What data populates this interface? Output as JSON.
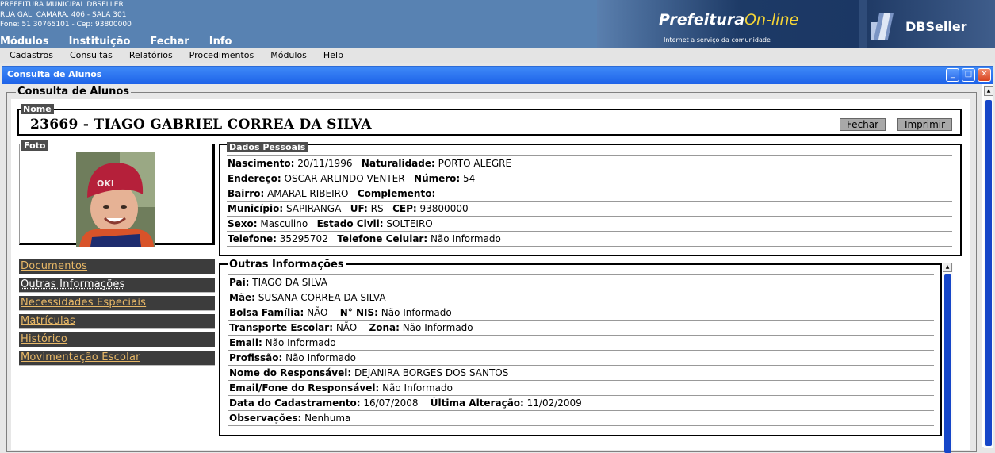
{
  "header": {
    "org_line1": "PREFEITURA MUNICIPAL DBSELLER",
    "org_line2": "RUA GAL. CAMARA, 406 - SALA 301",
    "org_line3": "Fone: 51 30765101  -  Cep: 93800000",
    "top_menu": [
      "Módulos",
      "Instituição",
      "Fechar",
      "Info"
    ],
    "banner_title_a": "Prefeitura",
    "banner_title_b": "On-line",
    "banner_subtitle": "Internet a serviço da comunidade",
    "brand": "DBSeller"
  },
  "menubar": [
    "Cadastros",
    "Consultas",
    "Relatórios",
    "Procedimentos",
    "Módulos",
    "Help"
  ],
  "window": {
    "title": "Consulta de Alunos",
    "min": "_",
    "max": "□",
    "close": "✕"
  },
  "form": {
    "legend": "Consulta de Alunos",
    "name_legend": "Nome",
    "student_line": "23669  -  TIAGO GABRIEL CORREA DA SILVA",
    "btn_fechar": "Fechar",
    "btn_imprimir": "Imprimir",
    "foto_legend": "Foto",
    "dados_legend": "Dados Pessoais",
    "outras_legend": "Outras Informações"
  },
  "nav": [
    "Documentos",
    "Outras Informações",
    "Necessidades Especiais",
    "Matrículas",
    "Histórico",
    "Movimentação Escolar"
  ],
  "dados": {
    "nascimento_l": "Nascimento:",
    "nascimento_v": " 20/11/1996",
    "naturalidade_l": "Naturalidade:",
    "naturalidade_v": " PORTO ALEGRE",
    "endereco_l": "Endereço:",
    "endereco_v": " OSCAR ARLINDO VENTER",
    "numero_l": "Número:",
    "numero_v": " 54",
    "bairro_l": "Bairro:",
    "bairro_v": " AMARAL RIBEIRO",
    "complemento_l": "Complemento:",
    "complemento_v": "",
    "municipio_l": "Município:",
    "municipio_v": " SAPIRANGA",
    "uf_l": "UF:",
    "uf_v": " RS",
    "cep_l": "CEP:",
    "cep_v": " 93800000",
    "sexo_l": "Sexo:",
    "sexo_v": " Masculino",
    "estadocivil_l": "Estado Civil:",
    "estadocivil_v": " SOLTEIRO",
    "telefone_l": "Telefone:",
    "telefone_v": " 35295702",
    "celular_l": "Telefone Celular:",
    "celular_v": " Não Informado"
  },
  "outras": {
    "pai_l": "Pai:",
    "pai_v": " TIAGO DA SILVA",
    "mae_l": "Mãe:",
    "mae_v": " SUSANA CORREA DA SILVA",
    "bolsa_l": "Bolsa Família:",
    "bolsa_v": " NÃO",
    "nis_l": "N° NIS:",
    "nis_v": " Não Informado",
    "transporte_l": "Transporte Escolar:",
    "transporte_v": " NÃO",
    "zona_l": "Zona:",
    "zona_v": " Não Informado",
    "email_l": "Email:",
    "email_v": " Não Informado",
    "profissao_l": "Profissão:",
    "profissao_v": " Não Informado",
    "responsavel_l": "Nome do Responsável:",
    "responsavel_v": " DEJANIRA BORGES DOS SANTOS",
    "emailresp_l": "Email/Fone do Responsável:",
    "emailresp_v": " Não Informado",
    "cadastro_l": "Data do Cadastramento:",
    "cadastro_v": " 16/07/2008",
    "alteracao_l": "Última Alteração:",
    "alteracao_v": " 11/02/2009",
    "obs_l": "Observações:",
    "obs_v": " Nenhuma"
  }
}
